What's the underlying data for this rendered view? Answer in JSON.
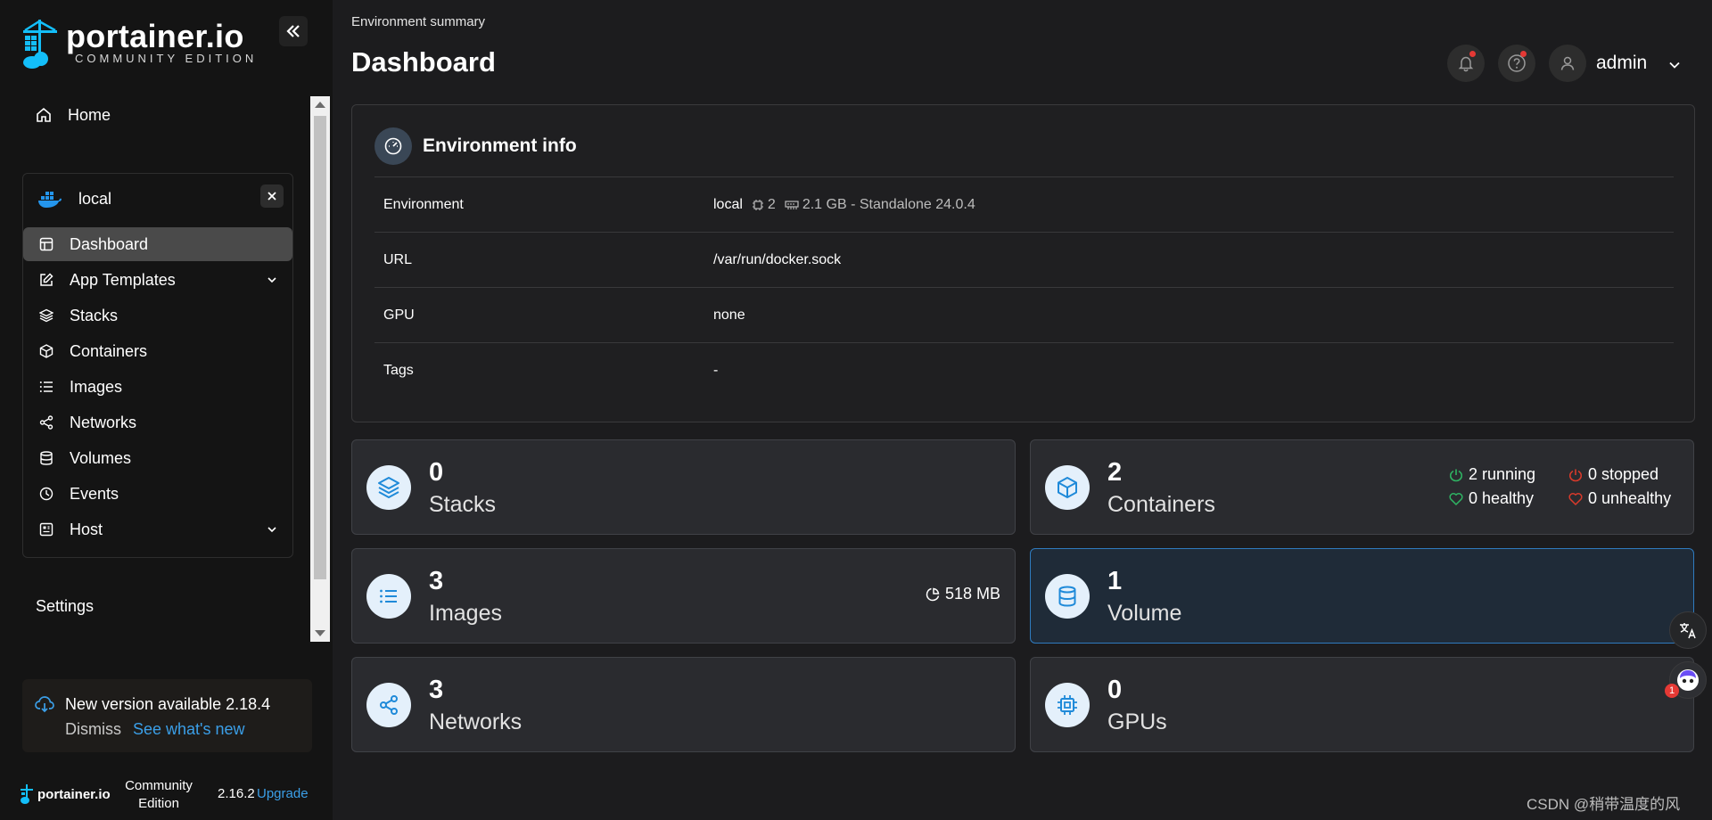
{
  "sidebar": {
    "logo_text": "portainer.io",
    "logo_sub": "COMMUNITY EDITION",
    "home_label": "Home",
    "environment_name": "local",
    "nav": [
      {
        "label": "Dashboard",
        "icon": "dashboard-icon",
        "active": true
      },
      {
        "label": "App Templates",
        "icon": "edit-icon",
        "expandable": true
      },
      {
        "label": "Stacks",
        "icon": "layers-icon"
      },
      {
        "label": "Containers",
        "icon": "box-icon"
      },
      {
        "label": "Images",
        "icon": "list-icon"
      },
      {
        "label": "Networks",
        "icon": "share-icon"
      },
      {
        "label": "Volumes",
        "icon": "database-icon"
      },
      {
        "label": "Events",
        "icon": "clock-icon"
      },
      {
        "label": "Host",
        "icon": "host-icon",
        "expandable": true
      }
    ],
    "settings_label": "Settings",
    "update": {
      "title": "New version available 2.18.4",
      "dismiss": "Dismiss",
      "link": "See what's new"
    },
    "footer": {
      "logo": "portainer.io",
      "edition": "Community Edition",
      "version": "2.16.2",
      "upgrade": "Upgrade"
    }
  },
  "header": {
    "breadcrumb": "Environment summary",
    "title": "Dashboard",
    "user": "admin"
  },
  "env_info": {
    "title": "Environment info",
    "rows": [
      {
        "key": "Environment",
        "value": "local",
        "cpu": "2",
        "memory": "2.1 GB - Standalone 24.0.4"
      },
      {
        "key": "URL",
        "value": "/var/run/docker.sock"
      },
      {
        "key": "GPU",
        "value": "none"
      },
      {
        "key": "Tags",
        "value": "-"
      }
    ]
  },
  "cards": {
    "stacks": {
      "count": "0",
      "label": "Stacks"
    },
    "containers": {
      "count": "2",
      "label": "Containers",
      "running": "2 running",
      "stopped": "0 stopped",
      "healthy": "0 healthy",
      "unhealthy": "0 unhealthy"
    },
    "images": {
      "count": "3",
      "label": "Images",
      "size": "518 MB"
    },
    "volume": {
      "count": "1",
      "label": "Volume"
    },
    "networks": {
      "count": "3",
      "label": "Networks"
    },
    "gpus": {
      "count": "0",
      "label": "GPUs"
    }
  },
  "colors": {
    "accent": "#3b9fe8",
    "running": "#2fb463",
    "stopped": "#d93a2b",
    "alert_dot": "#e53935"
  },
  "watermark": "CSDN @稍带温度的风",
  "badge_count": "1"
}
